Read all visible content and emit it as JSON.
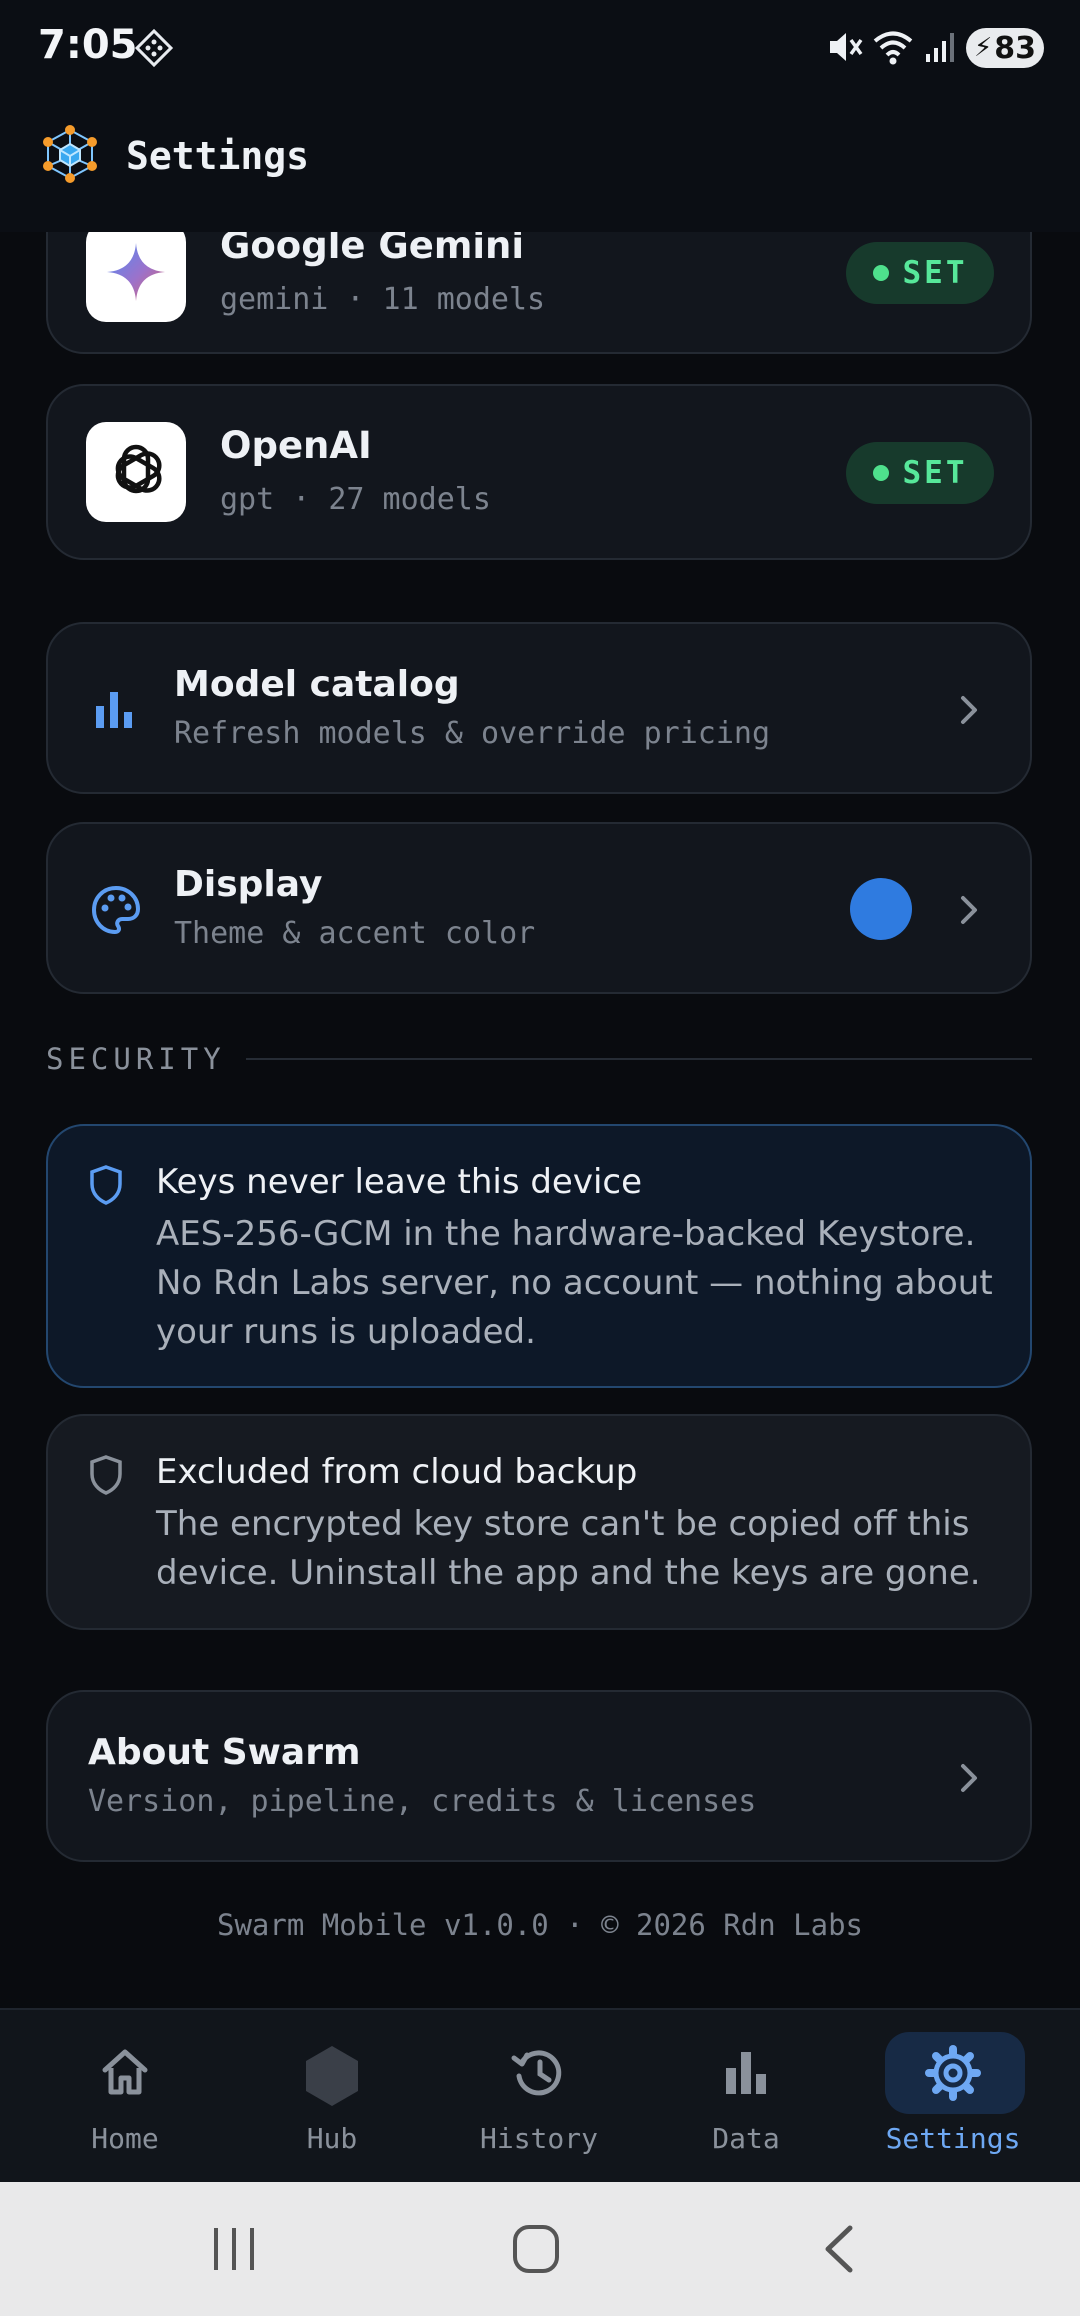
{
  "status_bar": {
    "time": "7:05",
    "battery": "83"
  },
  "app_bar": {
    "title": "Settings"
  },
  "providers": [
    {
      "name": "Google Gemini",
      "subtitle": "gemini · 11 models",
      "badge": "SET"
    },
    {
      "name": "OpenAI",
      "subtitle": "gpt · 27 models",
      "badge": "SET"
    }
  ],
  "model_catalog": {
    "title": "Model catalog",
    "subtitle": "Refresh models & override pricing"
  },
  "display": {
    "title": "Display",
    "subtitle": "Theme & accent color",
    "accent_color": "#2f7be0"
  },
  "security": {
    "label": "SECURITY",
    "items": [
      {
        "title": "Keys never leave this device",
        "body": "AES-256-GCM in the hardware-backed Keystore. No Rdn Labs server, no account — nothing about your runs is uploaded."
      },
      {
        "title": "Excluded from cloud backup",
        "body": "The encrypted key store can't be copied off this device. Uninstall the app and the keys are gone."
      }
    ]
  },
  "about": {
    "title": "About Swarm",
    "subtitle": "Version, pipeline, credits & licenses"
  },
  "footer": "Swarm Mobile v1.0.0 · © 2026 Rdn Labs",
  "bottom_nav": [
    {
      "label": "Home",
      "icon": "home-icon"
    },
    {
      "label": "Hub",
      "icon": "hexagon-icon"
    },
    {
      "label": "History",
      "icon": "history-icon"
    },
    {
      "label": "Data",
      "icon": "bar-chart-icon"
    },
    {
      "label": "Settings",
      "icon": "gear-icon",
      "active": true
    }
  ],
  "colors": {
    "accent": "#6ea8f3",
    "set_green": "#57e79a",
    "background": "#090b0f"
  }
}
